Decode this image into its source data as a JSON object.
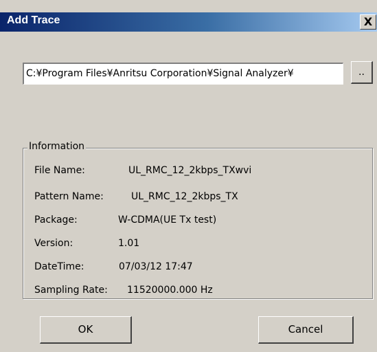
{
  "window": {
    "title": "Add Trace",
    "close_label": "X"
  },
  "path_field": {
    "value": "C:¥Program Files¥Anritsu Corporation¥Signal Analyzer¥",
    "browse_label": ".."
  },
  "information": {
    "group_label": "Information",
    "rows": [
      {
        "label": "File Name:",
        "value": "UL_RMC_12_2kbps_TXwvi"
      },
      {
        "label": "Pattern Name:",
        "value": "UL_RMC_12_2kbps_TX"
      },
      {
        "label": "Package:",
        "value": "W-CDMA(UE Tx test)"
      },
      {
        "label": "Version:",
        "value": "1.01"
      },
      {
        "label": "DateTime:",
        "value": "07/03/12 17:47"
      },
      {
        "label": "Sampling Rate:",
        "value": "11520000.000 Hz"
      }
    ]
  },
  "buttons": {
    "ok_label": "OK",
    "cancel_label": "Cancel"
  }
}
